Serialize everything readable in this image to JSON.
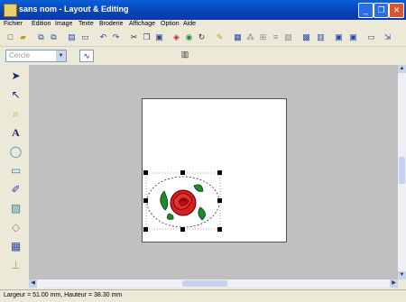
{
  "window": {
    "title": "sans nom - Layout & Editing",
    "minimize": "_",
    "restore": "❐",
    "close": "✕"
  },
  "menu": [
    "Fichier",
    "Edition",
    "Image",
    "Texte",
    "Broderie",
    "Affichage",
    "Option",
    "Aide"
  ],
  "toolbar": {
    "buttons": [
      "new-icon",
      "open-icon",
      "copy-icon",
      "paste-icon",
      "save-icon",
      "print-icon",
      "undo-icon",
      "redo-icon",
      "cut-icon",
      "copy2-icon",
      "paste2-icon",
      "color-icon",
      "zoom-icon",
      "refresh-icon",
      "magic-icon",
      "box-icon",
      "pattern-icon",
      "grid-icon",
      "distribute-icon",
      "preview-icon",
      "display-icon",
      "layout-icon",
      "stitch-icon",
      "monitor-icon",
      "card-icon",
      "send-icon"
    ],
    "combo_value": "Cercle"
  },
  "tools": [
    "select-arrow-icon",
    "point-edit-icon",
    "zoom-tool-icon",
    "text-tool-icon",
    "shape-tool-icon",
    "rectangle-tool-icon",
    "path-tool-icon",
    "fill-tool-icon",
    "eraser-tool-icon",
    "stitch-tool-icon",
    "stamp-tool-icon"
  ],
  "status": {
    "text": "Largeur = 51.00 mm, Hauteur = 38.30 mm"
  },
  "colors": {
    "rose": "#d42020",
    "leaf": "#1e8a2a",
    "title_blue": "#0842b8"
  }
}
